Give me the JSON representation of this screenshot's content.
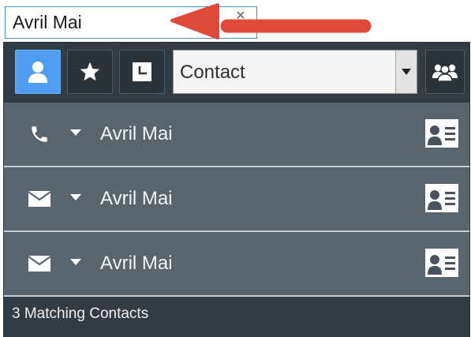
{
  "search": {
    "value": "Avril Mai"
  },
  "toolbar": {
    "buttons": [
      {
        "icon": "person-icon",
        "active": true
      },
      {
        "icon": "star-icon",
        "active": false
      },
      {
        "icon": "recent-icon",
        "active": false
      }
    ],
    "type_selector": {
      "selected": "Contact"
    },
    "directory_icon": "group-icon"
  },
  "results": [
    {
      "channel_icon": "phone-icon",
      "name": "Avril Mai"
    },
    {
      "channel_icon": "envelope-icon",
      "name": "Avril Mai"
    },
    {
      "channel_icon": "envelope-icon",
      "name": "Avril Mai"
    }
  ],
  "footer": {
    "status": "3 Matching Contacts"
  },
  "colors": {
    "accent": "#4f9ef2",
    "panel": "#3e474f",
    "row": "#59646d",
    "annotation_arrow": "#e04a3a"
  }
}
